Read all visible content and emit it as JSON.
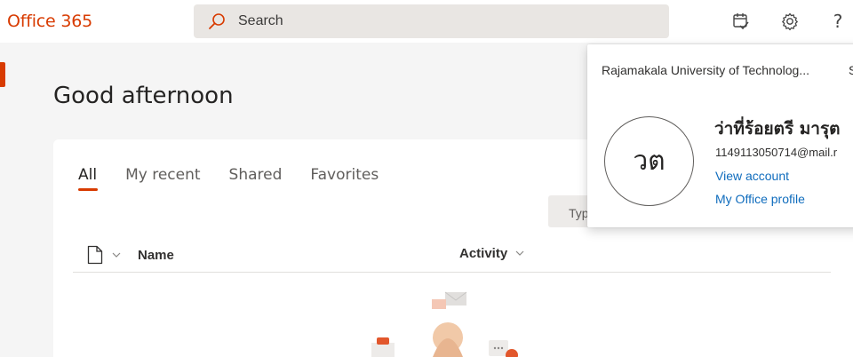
{
  "header": {
    "brand": "Office 365",
    "search_placeholder": "Search",
    "icons": [
      "tasks-icon",
      "settings-gear-icon",
      "help-question-icon"
    ],
    "help_glyph": "?"
  },
  "colors": {
    "accent": "#d83b01",
    "link": "#0f6cbd",
    "search_bg": "#e9e6e3"
  },
  "main": {
    "greeting": "Good afternoon",
    "tabs": [
      {
        "label": "All",
        "active": true
      },
      {
        "label": "My recent",
        "active": false
      },
      {
        "label": "Shared",
        "active": false
      },
      {
        "label": "Favorites",
        "active": false
      }
    ],
    "type_filter": "Typ",
    "columns": {
      "name": "Name",
      "activity": "Activity"
    }
  },
  "account": {
    "org": "Rajamakala University of Technolog...",
    "signout_partial": "S",
    "initials": "วต",
    "name": "ว่าที่ร้อยตรี มารุต",
    "email": "1149113050714@mail.r",
    "view_account": "View account",
    "office_profile": "My Office profile"
  }
}
